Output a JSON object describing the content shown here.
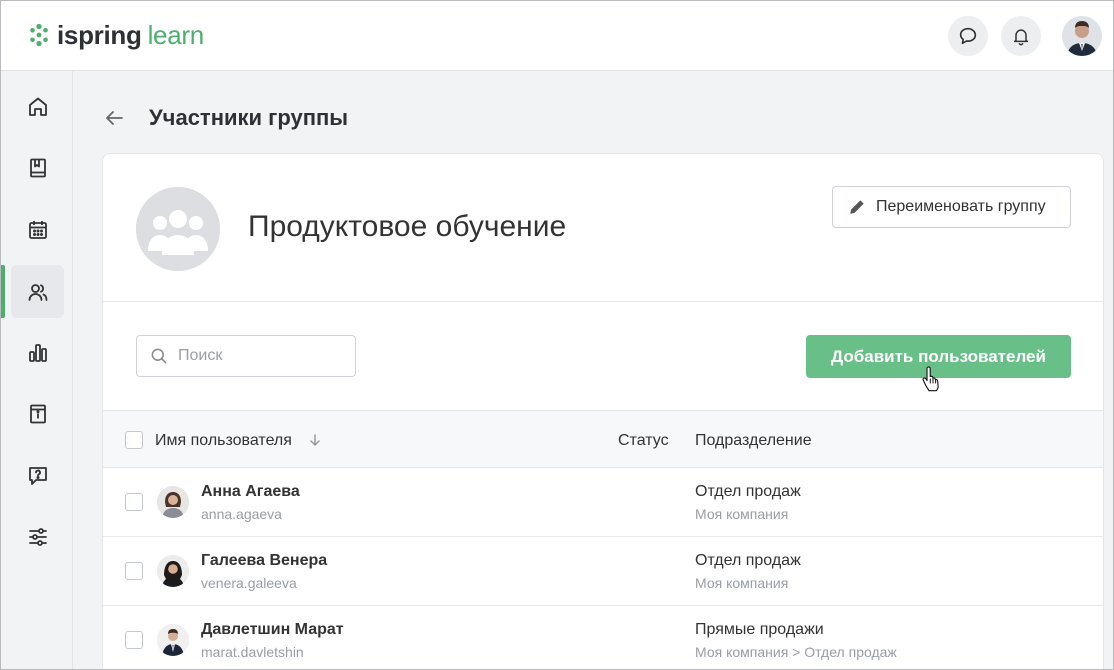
{
  "app": {
    "logo_primary": "ispring",
    "logo_secondary": "learn",
    "brand_color": "#4caf6e",
    "button_color": "#68c088"
  },
  "header": {
    "chat_icon": "chat-bubble-icon",
    "notifications_icon": "bell-icon",
    "profile_avatar": "user-photo"
  },
  "sidebar": {
    "items": [
      {
        "icon": "home-icon"
      },
      {
        "icon": "book-icon"
      },
      {
        "icon": "calendar-icon"
      },
      {
        "icon": "users-icon",
        "active": true
      },
      {
        "icon": "bar-chart-icon"
      },
      {
        "icon": "info-book-icon"
      },
      {
        "icon": "help-chat-icon"
      },
      {
        "icon": "sliders-icon"
      }
    ]
  },
  "page": {
    "title": "Участники группы",
    "group_name": "Продуктовое обучение",
    "rename_label": "Переименовать группу",
    "search_placeholder": "Поиск",
    "add_users_label": "Добавить пользователей"
  },
  "table": {
    "columns": {
      "name": "Имя пользователя",
      "status": "Статус",
      "department": "Подразделение"
    },
    "rows": [
      {
        "name": "Анна Агаева",
        "login": "anna.agaeva",
        "status": "",
        "department": "Отдел продаж",
        "company": "Моя компания"
      },
      {
        "name": "Галеева Венера",
        "login": "venera.galeeva",
        "status": "",
        "department": "Отдел продаж",
        "company": "Моя компания"
      },
      {
        "name": "Давлетшин Марат",
        "login": "marat.davletshin",
        "status": "",
        "department": "Прямые продажи",
        "company": "Моя компания > Отдел продаж"
      }
    ]
  }
}
